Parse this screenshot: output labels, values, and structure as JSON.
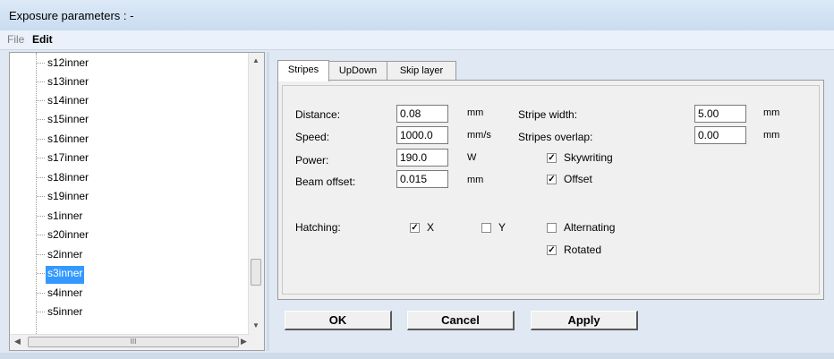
{
  "window": {
    "title": "Exposure parameters : -"
  },
  "menu": {
    "file": "File",
    "edit": "Edit"
  },
  "tree": {
    "items": [
      "s12inner",
      "s13inner",
      "s14inner",
      "s15inner",
      "s16inner",
      "s17inner",
      "s18inner",
      "s19inner",
      "s1inner",
      "s20inner",
      "s2inner",
      "s3inner",
      "s4inner",
      "s5inner"
    ],
    "selected": "s3inner",
    "scroll_glyph": "III"
  },
  "tabs": [
    "Stripes",
    "UpDown",
    "Skip layer"
  ],
  "form": {
    "distance": {
      "label": "Distance:",
      "value": "0.08",
      "unit": "mm"
    },
    "speed": {
      "label": "Speed:",
      "value": "1000.0",
      "unit": "mm/s"
    },
    "power": {
      "label": "Power:",
      "value": "190.0",
      "unit": "W"
    },
    "beam_offset": {
      "label": "Beam offset:",
      "value": "0.015",
      "unit": "mm"
    },
    "stripe_width": {
      "label": "Stripe width:",
      "value": "5.00",
      "unit": "mm"
    },
    "stripes_overlap": {
      "label": "Stripes overlap:",
      "value": "0.00",
      "unit": "mm"
    },
    "skywriting": {
      "label": "Skywriting",
      "checked": true
    },
    "offset": {
      "label": "Offset",
      "checked": true
    },
    "hatching_label": "Hatching:",
    "x": {
      "label": "X",
      "checked": true
    },
    "y": {
      "label": "Y",
      "checked": false
    },
    "alternating": {
      "label": "Alternating",
      "checked": false
    },
    "rotated": {
      "label": "Rotated",
      "checked": true
    }
  },
  "buttons": {
    "ok": "OK",
    "cancel": "Cancel",
    "apply": "Apply"
  }
}
